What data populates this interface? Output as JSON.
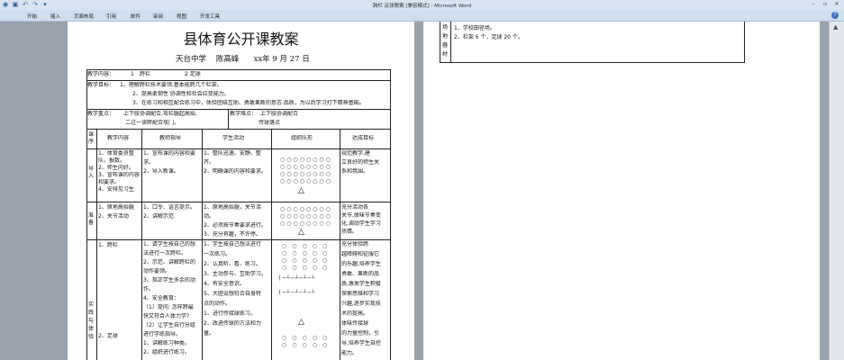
{
  "window": {
    "title": "跨栏 足球教案 [兼容模式] - Microsoft Word"
  },
  "ribbon": {
    "tabs": [
      "开始",
      "插入",
      "页面布局",
      "引用",
      "邮件",
      "审阅",
      "视图",
      "开发工具"
    ]
  },
  "doc": {
    "title": "县体育公开课教案",
    "school": "天台中学",
    "teacher": "陈高峰",
    "date_prefix": "xx",
    "date": "年 9 月 27 日",
    "content_label": "教学内容：",
    "content_1": "1　跨栏",
    "content_2": "2 足球",
    "goals_label": "教学目标：",
    "goal_1": "1、理解跨栏技术要领,基本能跨几个栏架。",
    "goal_2": "2、提高柔韧性 协调性和社会应变能力。",
    "goal_3": "3、在练习和相互配合练习中，体验团结互助、勇敢果断的意志 品质，为以后学习打下精神基础。",
    "key_label": "教学重点：",
    "key_1": "上下肢协调配合,攻栏腿起高抬,",
    "key_2": "二过一读畔配合攻门。",
    "diff_label": "教学难点：",
    "diff_1": "上下肢协调配合",
    "diff_2": "传球落点",
    "headers": {
      "col0": "课序",
      "col1": "教学内容",
      "col2": "教师指导",
      "col3": "学生活动",
      "col4": "组织队形",
      "col5": "达成目标"
    },
    "section_intro": "导入",
    "intro_content": [
      "1、体育委员整",
      "队，报数。",
      "2、师生问好。",
      "3、宣布课的内容",
      "和要求。",
      "4、安排见习生"
    ],
    "intro_teacher": [
      "1、宣布课的内容和要",
      "求。",
      "2、导入新课。"
    ],
    "intro_student": [
      "1、整队迅速、安静、整",
      "齐。",
      "2、明确课的内容和要求。"
    ],
    "intro_goal": [
      "规范教学,建",
      "立良好的师生关",
      "系和氛围。"
    ],
    "section_warm": "准备",
    "warm_content": [
      "1、原地高抬腿",
      "2、关节活动"
    ],
    "warm_teacher": [
      "1、口令、语言提示。",
      "2、讲解示范"
    ],
    "warm_student": [
      "1、原地高抬腿，关节活",
      "动。",
      "2、必须按节奏要求进行。",
      "3、充分有趣，不许停。"
    ],
    "warm_goal": [
      "充分活动各",
      "关节,体味节奏变",
      "化,调动学生学习",
      "热情。"
    ],
    "section_main": "实践与体验",
    "main_content_1": "1、跨栏",
    "main_content_2": "2、足球",
    "main_teacher": [
      "1、请学生按自己的想",
      "法进行一次跨栏。",
      "2、示范、讲解跨栏的",
      "动作要领。",
      "3、指正学生多余的动",
      "作。",
      "4、安全教育：",
      "（1）提问: 怎样跨最",
      "快又符合人体力学?",
      "（2）让学生自行分组",
      "进行学练指导。",
      "1、讲解练习种类。",
      "2、组织进行练习。"
    ],
    "main_student": [
      "1、学生按自己想法进行",
      "一次练习。",
      "2、认真听、看、练习。",
      "3、主动参与、互助学习。",
      "4、有安全意识。",
      "5、大胆设想符合自身特",
      "点的动作。",
      "1、进行传接球练习。",
      "2、改进传球的方法和力",
      "量。"
    ],
    "main_goal": [
      "充分体验跨",
      "越障碍和征服它",
      "的乐趣,培养学生",
      "勇敢、果断的品",
      "质,激发学生积极",
      "探索思维和学习",
      "兴趣,逐步实现技",
      "术的提高。",
      "体味传接球",
      "的力量控制，引",
      "导,培养学生自控",
      "能力。"
    ],
    "p2_side": [
      "场",
      "地",
      "器",
      "材"
    ],
    "p2_line1": "1、学校田径场。",
    "p2_line2": "2、栏架 6 个，足球 20 个。"
  }
}
